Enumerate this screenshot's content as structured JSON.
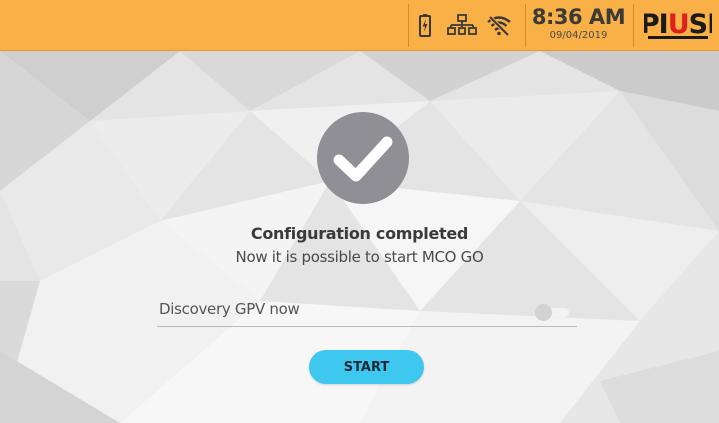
{
  "status_bar": {
    "time": "8:36 AM",
    "date": "09/04/2019",
    "icons": [
      "battery-charging-icon",
      "network-icon",
      "wifi-off-icon"
    ],
    "logo_text": "PIUSI",
    "background_color": "#f9b046"
  },
  "main": {
    "status_icon": "check-icon",
    "title": "Configuration completed",
    "subtitle": "Now it is possible to start MCO GO",
    "option": {
      "label": "Discovery GPV now",
      "toggle_on": false
    },
    "start_button": {
      "label": "START",
      "color": "#3ec8ef"
    }
  }
}
